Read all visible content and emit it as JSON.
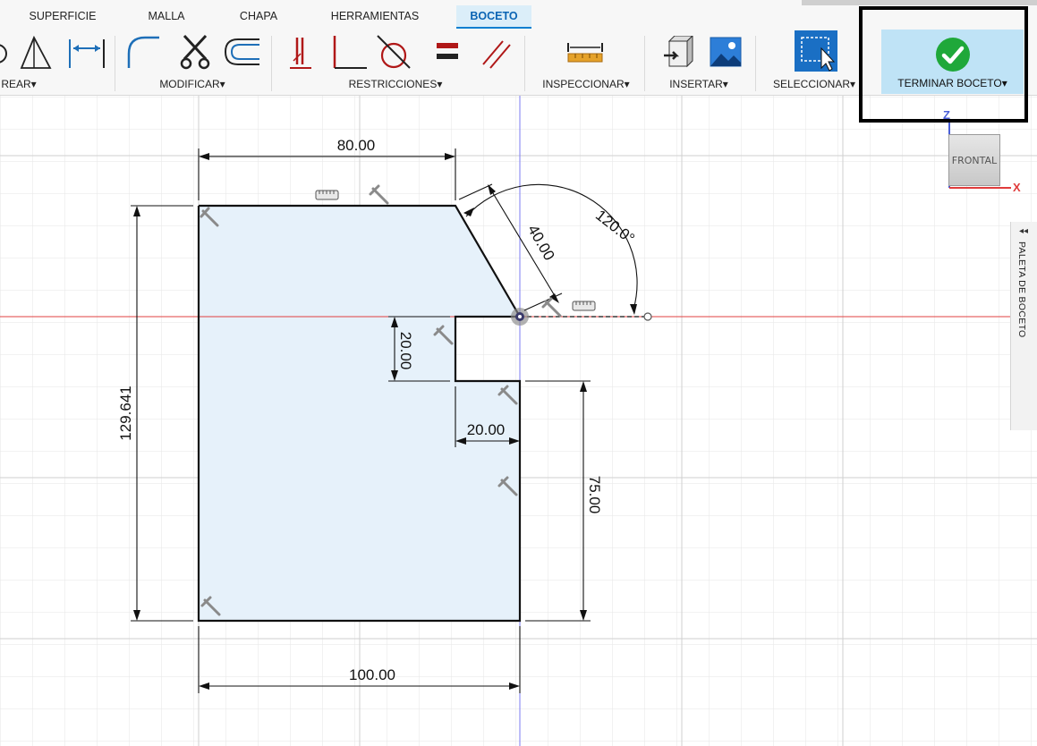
{
  "tabs": [
    "SUPERFICIE",
    "MALLA",
    "CHAPA",
    "HERRAMIENTAS",
    "BOCETO"
  ],
  "active_tab": "BOCETO",
  "ribbon_groups": {
    "crear": "REAR",
    "modificar": "MODIFICAR",
    "restricciones": "RESTRICCIONES",
    "inspeccionar": "INSPECCIONAR",
    "insertar": "INSERTAR",
    "seleccionar": "SELECCIONAR",
    "terminar": "TERMINAR BOCETO"
  },
  "dropdown_arrow": "▾",
  "viewcube": {
    "face": "FRONTAL",
    "axis_z": "Z",
    "axis_x": "X"
  },
  "palette": {
    "label": "PALETA DE BOCETO",
    "collapse_icon": "◂◂"
  },
  "dimensions": {
    "top_width": "80.00",
    "chamfer_length": "40.00",
    "angle": "120.0°",
    "left_height": "129.641",
    "notch_height": "20.00",
    "notch_width": "20.00",
    "right_height": "75.00",
    "bottom_width": "100.00"
  },
  "colors": {
    "accent": "#0a7fd0",
    "finish_bg": "#bfe3f6",
    "check_green": "#1fa83a",
    "sketch_fill": "#e6f1fa",
    "x_axis": "#e04040",
    "y_axis": "#7b7bf2"
  }
}
